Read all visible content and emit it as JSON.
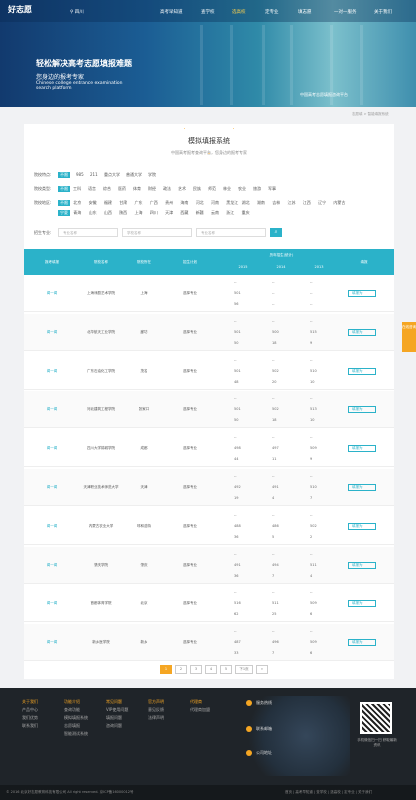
{
  "header": {
    "logo": "好志愿",
    "location": "四川",
    "nav": [
      "高考早知道",
      "查学校",
      "选高校",
      "定专业",
      "填志愿",
      "一对一服务",
      "关于我们"
    ],
    "slogan": "轻松解决高考志愿填报难题",
    "slogan2": "您身边的报考专家",
    "slogan3": "Chinese college entrance examination search platform",
    "hero_right": "中国高考志愿填报咨询平台"
  },
  "breadcrumb": "志愿填 > 智能填报系统",
  "main": {
    "title": "模拟填报系统",
    "subtitle": "中国高考报考查询平台，您身边的报考专家",
    "filters": {
      "label_attr": "院校特点:",
      "attr": [
        "不限",
        "985",
        "211",
        "重点大学",
        "普通大学",
        "学院"
      ],
      "label_type": "院校类型:",
      "type": [
        "不限",
        "工科",
        "语言",
        "综合",
        "医药",
        "体育",
        "财经",
        "政法",
        "艺术",
        "民族",
        "师范",
        "林业",
        "农业",
        "旅游",
        "军事"
      ],
      "label_area": "院校地区:",
      "area1": [
        "不限",
        "北京",
        "安徽",
        "福建",
        "甘肃",
        "广东",
        "广西",
        "贵州",
        "海南",
        "河北",
        "河南",
        "黑龙江",
        "湖北",
        "湖南",
        "吉林",
        "江苏",
        "江西",
        "辽宁",
        "内蒙古"
      ],
      "area2": [
        "宁夏",
        "青海",
        "山东",
        "山西",
        "陕西",
        "上海",
        "四川",
        "天津",
        "西藏",
        "新疆",
        "云南",
        "浙江",
        "重庆"
      ],
      "label_major": "招生专业:",
      "ph1": "专业名称",
      "ph2": "学校名称",
      "ph3": "专业名称",
      "search_icon": "search-icon"
    },
    "table": {
      "headers": [
        "报考填报",
        "院校名称",
        "院校所在",
        "招生计划",
        "历年招生(统计)",
        "填报"
      ],
      "years": [
        "2015",
        "2014",
        "2013"
      ],
      "rows": [
        {
          "op": "闻一闻",
          "name": "上海戏剧艺术学院",
          "loc": "上海",
          "plan": "选择专业",
          "v": [
            [
              "--",
              "--",
              "--"
            ],
            [
              "501",
              "--",
              "--"
            ],
            [
              "56",
              "--",
              "--"
            ]
          ]
        },
        {
          "op": "闻一闻",
          "name": "北华航天工业学院",
          "loc": "廊坊",
          "plan": "选择专业",
          "v": [
            [
              "--",
              "--",
              "--"
            ],
            [
              "501",
              "500",
              "515"
            ],
            [
              "50",
              "18",
              "9"
            ]
          ]
        },
        {
          "op": "闻一闻",
          "name": "广东石油化工学院",
          "loc": "茂名",
          "plan": "选择专业",
          "v": [
            [
              "--",
              "--",
              "--"
            ],
            [
              "501",
              "502",
              "510"
            ],
            [
              "48",
              "20",
              "10"
            ]
          ]
        },
        {
          "op": "闻一闻",
          "name": "河北建筑工程学院",
          "loc": "张家口",
          "plan": "选择专业",
          "v": [
            [
              "--",
              "--",
              "--"
            ],
            [
              "501",
              "502",
              "513"
            ],
            [
              "50",
              "18",
              "10"
            ]
          ]
        },
        {
          "op": "闻一闻",
          "name": "四川大学锦城学院",
          "loc": "成都",
          "plan": "选择专业",
          "v": [
            [
              "--",
              "--",
              "--"
            ],
            [
              "498",
              "497",
              "509"
            ],
            [
              "44",
              "11",
              "9"
            ]
          ]
        },
        {
          "op": "闻一闻",
          "name": "天津职业技术师范大学",
          "loc": "天津",
          "plan": "选择专业",
          "v": [
            [
              "--",
              "--",
              "--"
            ],
            [
              "492",
              "491",
              "510"
            ],
            [
              "19",
              "4",
              "7"
            ]
          ]
        },
        {
          "op": "闻一闻",
          "name": "内蒙古农业大学",
          "loc": "呼和浩特",
          "plan": "选择专业",
          "v": [
            [
              "--",
              "--",
              "--"
            ],
            [
              "488",
              "486",
              "502"
            ],
            [
              "36",
              "5",
              "2"
            ]
          ]
        },
        {
          "op": "闻一闻",
          "name": "肇庆学院",
          "loc": "肇庆",
          "plan": "选择专业",
          "v": [
            [
              "--",
              "--",
              "--"
            ],
            [
              "491",
              "494",
              "511"
            ],
            [
              "36",
              "7",
              "4"
            ]
          ]
        },
        {
          "op": "闻一闻",
          "name": "首都体育学院",
          "loc": "北京",
          "plan": "选择专业",
          "v": [
            [
              "--",
              "--",
              "--"
            ],
            [
              "516",
              "511",
              "509"
            ],
            [
              "62",
              "25",
              "6"
            ]
          ]
        },
        {
          "op": "闻一闻",
          "name": "新乡医学院",
          "loc": "新乡",
          "plan": "选择专业",
          "v": [
            [
              "--",
              "--",
              "--"
            ],
            [
              "487",
              "496",
              "509"
            ],
            [
              "33",
              "7",
              "6"
            ]
          ]
        }
      ],
      "fill_label": "填报为"
    },
    "pager": [
      "1",
      "2",
      "3",
      "4",
      "5",
      "下1页",
      "»"
    ]
  },
  "side": "在线咨询",
  "footer": {
    "cols": [
      {
        "h": "关于我们",
        "items": [
          "产品中心",
          "我们优势",
          "联系我们"
        ]
      },
      {
        "h": "功能介绍",
        "items": [
          "查询功能",
          "模拟填报系统",
          "志愿填报",
          "智能测试系统"
        ]
      },
      {
        "h": "常见问题",
        "items": [
          "VIP使用问题",
          "填报问题",
          "咨询问题"
        ]
      },
      {
        "h": "官方声明",
        "items": [
          "意见反馈",
          "法律声明"
        ]
      },
      {
        "h": "代理商",
        "items": [
          "代理商加盟"
        ]
      }
    ],
    "c1": "服务热线",
    "c2": "联系邮箱",
    "c3": "公司地址",
    "qr": "手机微信扫一扫 获取最新资讯"
  },
  "copyright": "© 2016 北京好志愿教育科技有限公司 All right reserved. 京ICP备16000012号",
  "links": "首页 | 高考早知道 | 查学校 | 选高校 | 定专业 | 关于我们"
}
